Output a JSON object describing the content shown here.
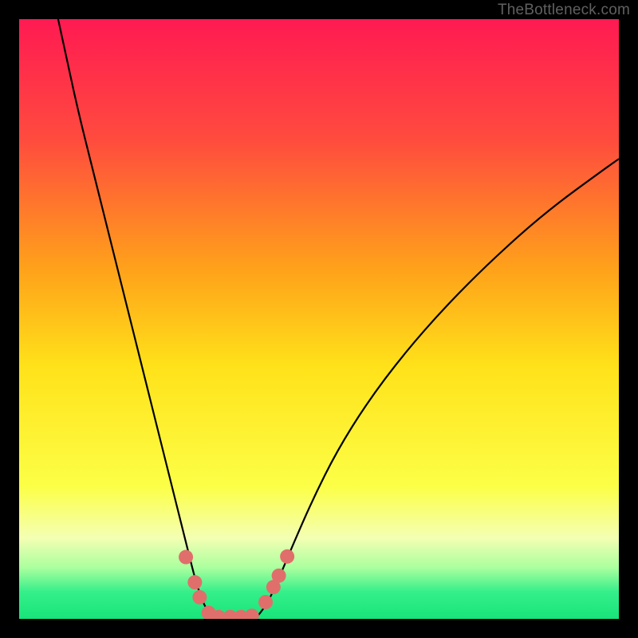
{
  "attribution": "TheBottleneck.com",
  "chart_data": {
    "type": "line",
    "title": "",
    "xlabel": "",
    "ylabel": "",
    "xlim": [
      0,
      100
    ],
    "ylim": [
      0,
      100
    ],
    "gradient_stops": [
      {
        "offset": 0.0,
        "color": "#ff1a52"
      },
      {
        "offset": 0.2,
        "color": "#ff4b3e"
      },
      {
        "offset": 0.42,
        "color": "#ffa31a"
      },
      {
        "offset": 0.58,
        "color": "#ffe21a"
      },
      {
        "offset": 0.78,
        "color": "#fcff47"
      },
      {
        "offset": 0.865,
        "color": "#f4ffb3"
      },
      {
        "offset": 0.915,
        "color": "#aaff9e"
      },
      {
        "offset": 0.955,
        "color": "#35ef8a"
      },
      {
        "offset": 1.0,
        "color": "#18e47a"
      }
    ],
    "series": [
      {
        "name": "left-curve",
        "x": [
          6.5,
          8,
          10,
          12,
          14,
          16,
          18,
          20,
          22,
          24,
          26,
          28,
          29.5,
          31,
          32.5
        ],
        "y": [
          100,
          93,
          84,
          76,
          68,
          60,
          52,
          44,
          36,
          28,
          20,
          12,
          6,
          1.8,
          0.2
        ]
      },
      {
        "name": "right-curve",
        "x": [
          39.5,
          41,
          43,
          45.5,
          49,
          53,
          58,
          64,
          71,
          79,
          88,
          98,
          100
        ],
        "y": [
          0.2,
          1.8,
          6,
          12,
          20,
          28,
          36,
          44,
          52,
          60,
          68,
          75.3,
          76.7
        ]
      }
    ],
    "markers": [
      {
        "x": 27.8,
        "y": 10.3
      },
      {
        "x": 29.3,
        "y": 6.1
      },
      {
        "x": 30.1,
        "y": 3.6
      },
      {
        "x": 31.6,
        "y": 1.0
      },
      {
        "x": 33.3,
        "y": 0.3
      },
      {
        "x": 35.2,
        "y": 0.3
      },
      {
        "x": 37.0,
        "y": 0.3
      },
      {
        "x": 38.8,
        "y": 0.5
      },
      {
        "x": 41.1,
        "y": 2.8
      },
      {
        "x": 42.4,
        "y": 5.3
      },
      {
        "x": 43.3,
        "y": 7.2
      },
      {
        "x": 44.7,
        "y": 10.4
      }
    ],
    "marker_color": "#e06f6b",
    "marker_radius": 9
  }
}
